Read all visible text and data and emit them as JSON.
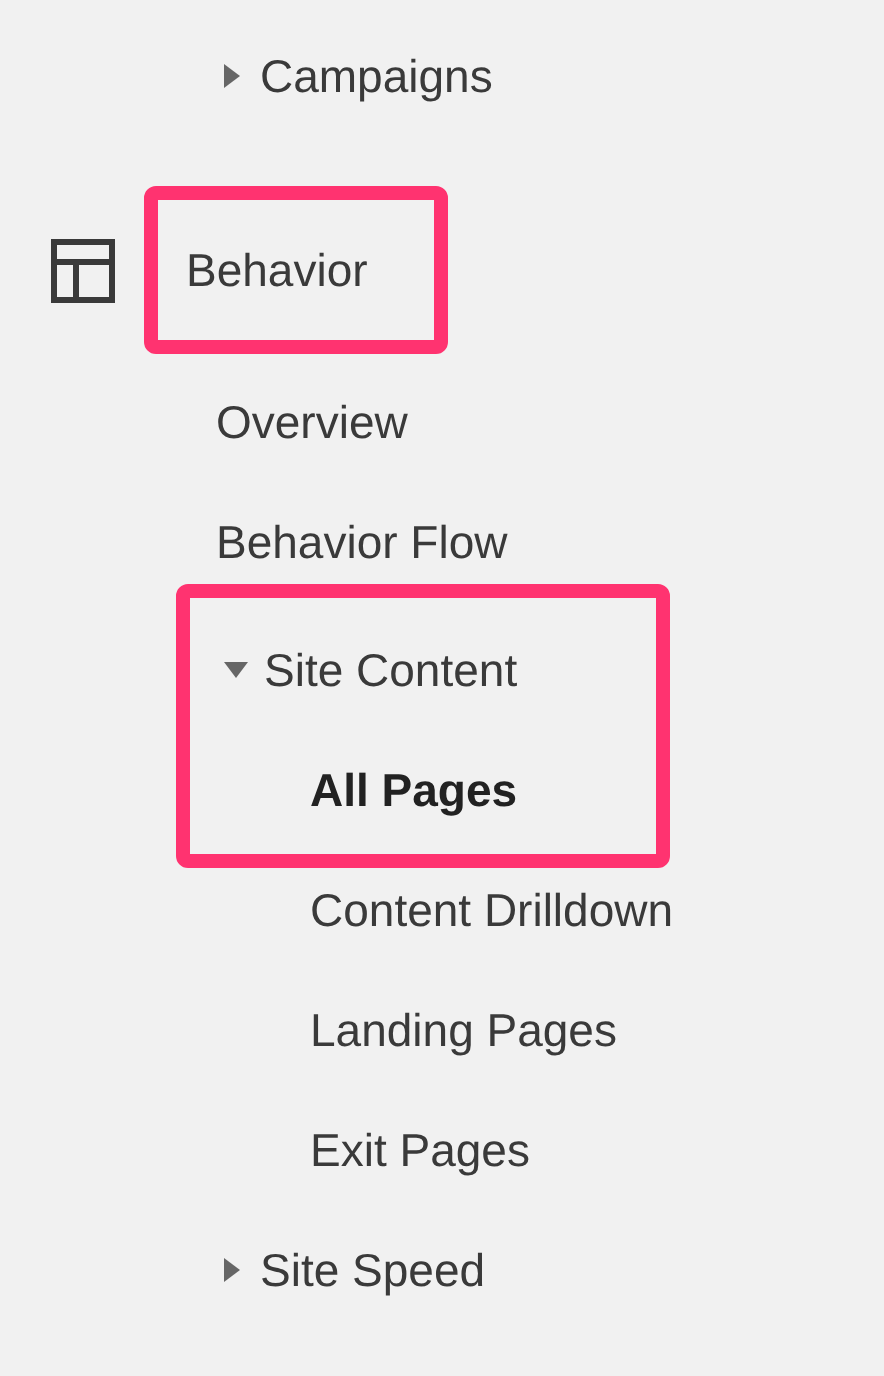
{
  "items": [
    {
      "kind": "group",
      "label": "Campaigns",
      "expanded": false
    },
    {
      "kind": "section",
      "label": "Behavior",
      "highlighted": true
    },
    {
      "kind": "link",
      "label": "Overview"
    },
    {
      "kind": "link",
      "label": "Behavior Flow"
    },
    {
      "kind": "group",
      "label": "Site Content",
      "expanded": true,
      "highlighted": true,
      "children": [
        {
          "label": "All Pages",
          "selected": true,
          "highlighted": true
        },
        {
          "label": "Content Drilldown",
          "selected": false
        },
        {
          "label": "Landing Pages",
          "selected": false
        },
        {
          "label": "Exit Pages",
          "selected": false
        }
      ]
    },
    {
      "kind": "group",
      "label": "Site Speed",
      "expanded": false
    }
  ]
}
